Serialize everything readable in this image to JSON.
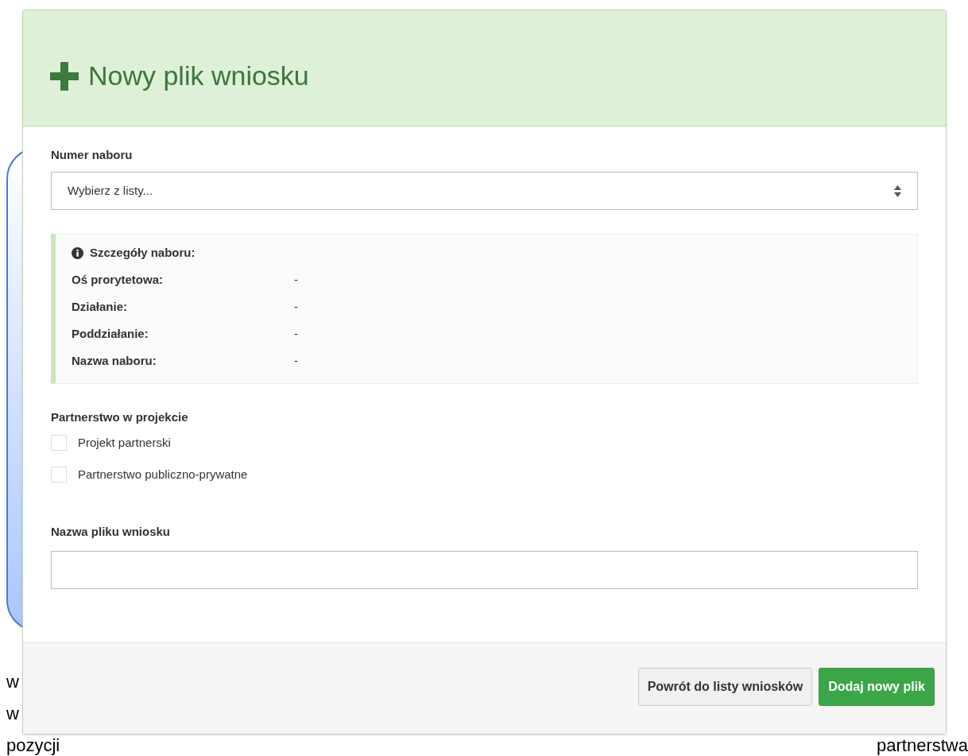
{
  "document_text": [
    {
      "text": "w"
    },
    {
      "text": "w"
    },
    {
      "text": "pozycji"
    },
    {
      "text": "partnerstwa"
    }
  ],
  "dialog": {
    "title": "Nowy plik wniosku",
    "recruitment_number": {
      "label": "Numer naboru",
      "value": "Wybierz z listy..."
    },
    "details": {
      "heading": "Szczegóły naboru:",
      "rows": [
        {
          "label": "Oś prorytetowa:",
          "value": "-"
        },
        {
          "label": "Działanie:",
          "value": "-"
        },
        {
          "label": "Poddziałanie:",
          "value": "-"
        },
        {
          "label": "Nazwa naboru:",
          "value": "-"
        }
      ]
    },
    "partnership": {
      "label": "Partnerstwo w projekcie",
      "options": [
        {
          "label": "Projekt partnerski",
          "checked": false
        },
        {
          "label": "Partnerstwo publiczno-prywatne",
          "checked": false
        }
      ]
    },
    "file_name": {
      "label": "Nazwa pliku wniosku"
    },
    "buttons": [
      {
        "label": "Powrót do listy wniosków",
        "kind": "default"
      },
      {
        "label": "Dodaj nowy plik",
        "kind": "primary"
      }
    ]
  }
}
